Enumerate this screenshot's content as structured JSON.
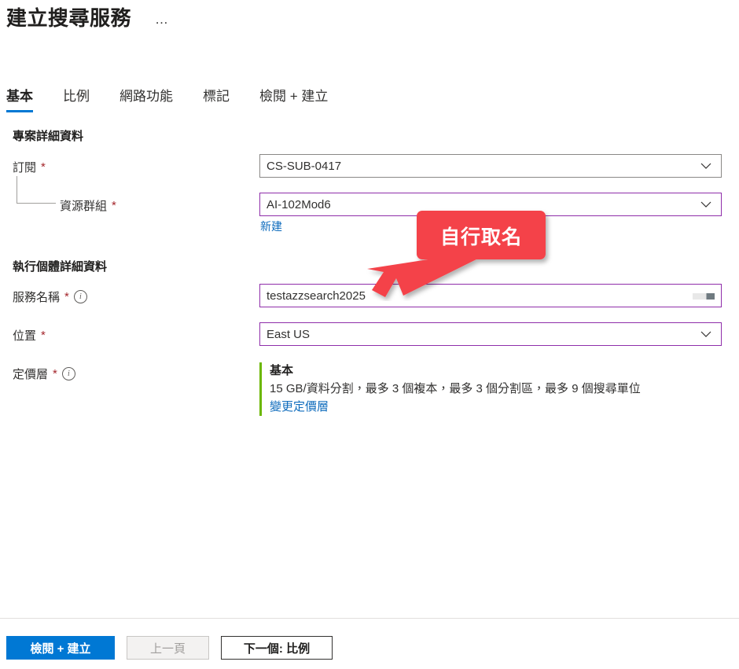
{
  "header": {
    "title": "建立搜尋服務",
    "overflow_menu": "…"
  },
  "tabs": [
    {
      "label": "基本",
      "active": true
    },
    {
      "label": "比例",
      "active": false
    },
    {
      "label": "網路功能",
      "active": false
    },
    {
      "label": "標記",
      "active": false
    },
    {
      "label": "檢閱 + 建立",
      "active": false
    }
  ],
  "sections": {
    "project_details": {
      "heading": "專案詳細資料",
      "subscription": {
        "label": "訂閱",
        "required": "*",
        "value": "CS-SUB-0417",
        "chevron_icon": "chevron-down-icon"
      },
      "resource_group": {
        "label": "資源群組",
        "required": "*",
        "value": "AI-102Mod6",
        "chevron_icon": "chevron-down-icon",
        "create_new_link": "新建"
      }
    },
    "instance_details": {
      "heading": "執行個體詳細資料",
      "service_name": {
        "label": "服務名稱",
        "required": "*",
        "info_icon": "info-icon",
        "value": "testazzsearch2025",
        "placeholder": ""
      },
      "location": {
        "label": "位置",
        "required": "*",
        "value": "East US",
        "chevron_icon": "chevron-down-icon"
      },
      "pricing_tier": {
        "label": "定價層",
        "required": "*",
        "info_icon": "info-icon",
        "tier_name": "基本",
        "tier_description": "15 GB/資料分割，最多 3 個複本，最多 3 個分割區，最多 9 個搜尋單位",
        "change_link": "變更定價層"
      }
    }
  },
  "annotation": {
    "text": "自行取名",
    "color": "#f4434a",
    "arrow_icon": "arrow-down-left-icon"
  },
  "footer": {
    "review_create": "檢閱 + 建立",
    "previous": "上一頁",
    "next": "下一個: 比例"
  },
  "colors": {
    "accent": "#0078d4",
    "focus_border": "#8f2eaa",
    "link": "#0f6cbd",
    "required": "#a4262c",
    "tier_bar": "#6bb700",
    "annotation": "#f4434a"
  }
}
